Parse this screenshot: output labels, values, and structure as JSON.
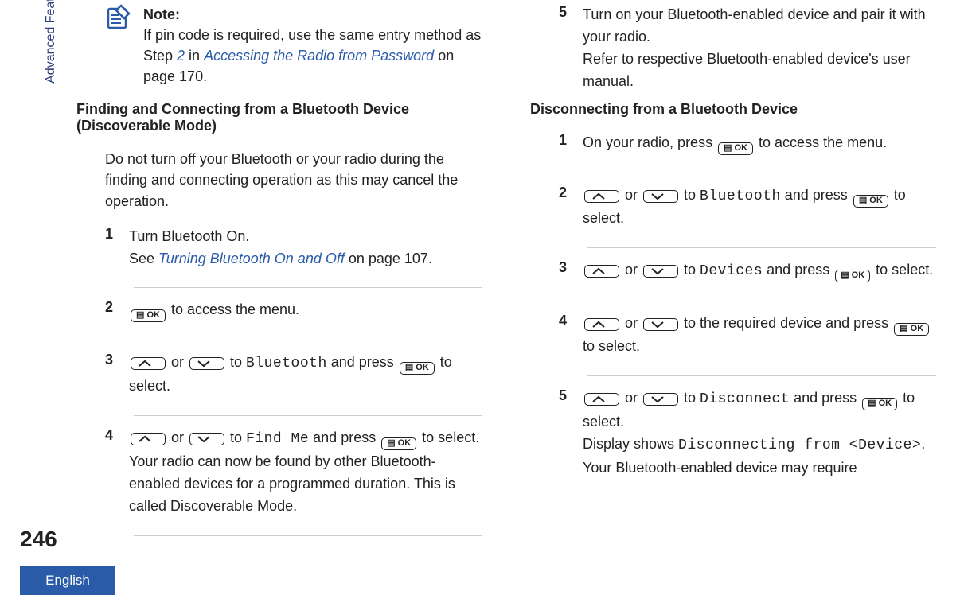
{
  "sideTab": "Advanced Features in Connect Plus Mode",
  "pageNumber": "246",
  "language": "English",
  "keys": {
    "ok": "OK"
  },
  "note": {
    "label": "Note:",
    "text_pre": "If pin code is required, use the same entry method as Step ",
    "step_link": "2",
    "text_mid": " in ",
    "link": "Accessing the Radio from Password",
    "text_suf": " on page 170."
  },
  "sectionA": {
    "title": "Finding and Connecting from a Bluetooth Device (Discoverable Mode)",
    "intro": "Do not turn off your Bluetooth or your radio during the finding and connecting operation as this may cancel the operation.",
    "steps": [
      {
        "n": "1",
        "body_pre": "Turn Bluetooth On.",
        "body_br": true,
        "link_pre": "See ",
        "link": "Turning Bluetooth On and Off",
        "link_suf": " on page 107."
      },
      {
        "n": "2",
        "type": "menu",
        "suffix": " to access the menu."
      },
      {
        "n": "3",
        "type": "navsel",
        "target": "Bluetooth",
        "suffix": " to select."
      },
      {
        "n": "4",
        "type": "navsel",
        "target": "Find Me",
        "suffix": " to select.",
        "tail": "Your radio can now be found by other Bluetooth-enabled devices for a programmed duration. This is called Discoverable Mode."
      },
      {
        "n": "5",
        "plain": "Turn on your Bluetooth-enabled device and pair it with your radio.",
        "tail": "Refer to respective Bluetooth-enabled device's user manual."
      }
    ]
  },
  "sectionB": {
    "title": "Disconnecting from a Bluetooth Device",
    "steps": [
      {
        "n": "1",
        "type": "pressmenu",
        "pre": "On your radio, press ",
        "suffix": " to access the menu."
      },
      {
        "n": "2",
        "type": "navsel",
        "target": "Bluetooth",
        "suffix": " to select."
      },
      {
        "n": "3",
        "type": "navsel",
        "target": "Devices",
        "suffix": " to select."
      },
      {
        "n": "4",
        "type": "navplain",
        "mid": " to the required device and press ",
        "suffix": " to select."
      },
      {
        "n": "5",
        "type": "navsel",
        "target": "Disconnect",
        "suffix": " to select.",
        "tail_pre": "Display shows ",
        "tail_mono": "Disconnecting from <Device>",
        "tail_suf": ". Your Bluetooth-enabled device may require"
      }
    ]
  }
}
